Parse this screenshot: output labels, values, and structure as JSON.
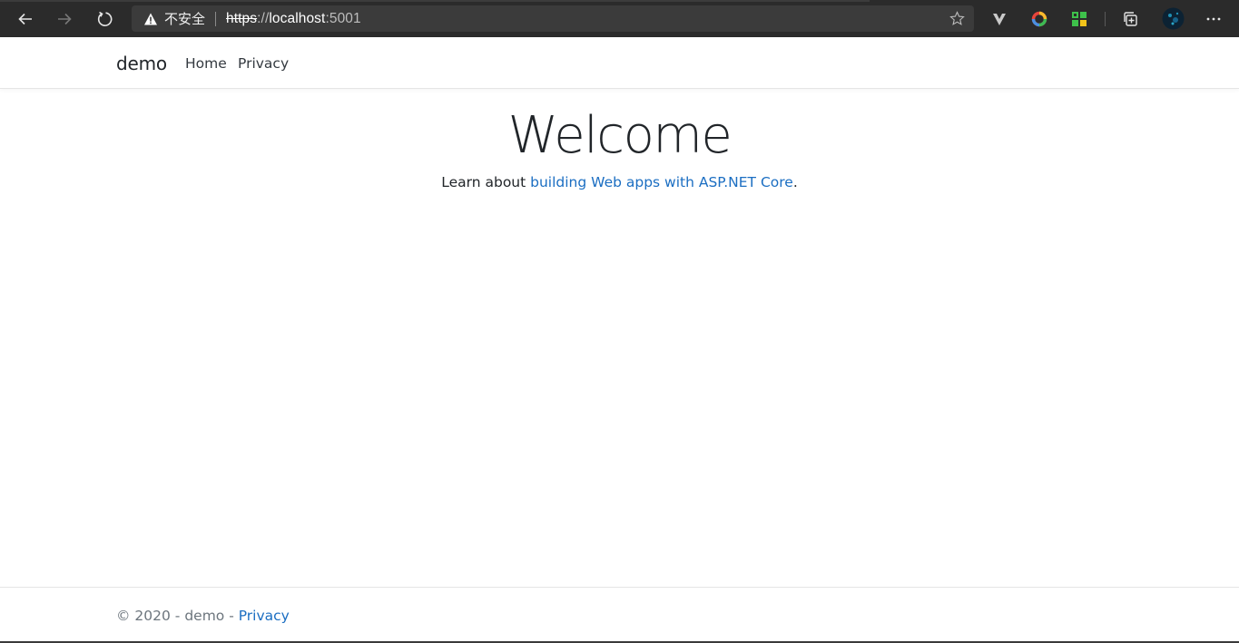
{
  "browser": {
    "security_label": "不安全",
    "url_scheme": "https",
    "url_sep": "://",
    "url_host": "localhost",
    "url_port": ":5001",
    "icons": {
      "back": "arrow-left-icon",
      "forward": "arrow-right-icon",
      "reload": "reload-icon",
      "warning": "warning-icon",
      "favorite": "star-icon",
      "extension_v": "v-extension-icon",
      "extension_ring": "ring-extension-icon",
      "extension_grid": "grid-extension-icon",
      "collections": "collections-icon",
      "profile": "profile-avatar-icon",
      "more": "more-icon"
    }
  },
  "navbar": {
    "brand": "demo",
    "links": [
      {
        "label": "Home"
      },
      {
        "label": "Privacy"
      }
    ]
  },
  "main": {
    "heading": "Welcome",
    "lead_prefix": "Learn about ",
    "lead_link": "building Web apps with ASP.NET Core",
    "lead_suffix": "."
  },
  "footer": {
    "text": "© 2020 - demo - ",
    "link": "Privacy"
  },
  "colors": {
    "link": "#1b6ec2",
    "chrome_bg": "#2b2b2b",
    "omnibox_bg": "#3b3b3b"
  }
}
